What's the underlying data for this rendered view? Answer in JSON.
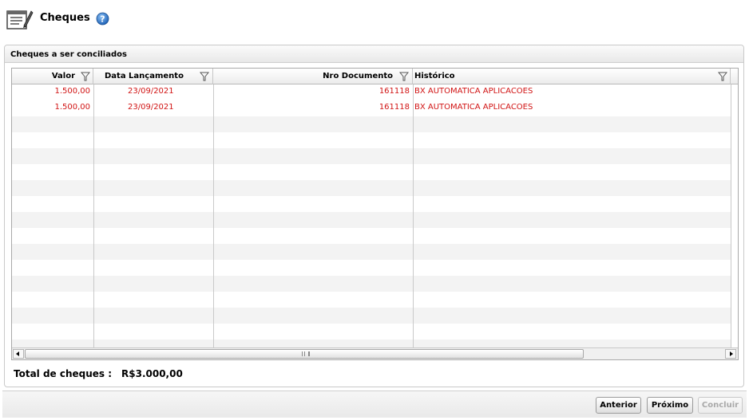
{
  "header": {
    "title": "Cheques"
  },
  "panel": {
    "title": "Cheques a ser conciliados",
    "columns": [
      "Valor",
      "Data Lançamento",
      "Nro Documento",
      "Histórico"
    ],
    "rows": [
      {
        "valor": "1.500,00",
        "data": "23/09/2021",
        "nro": "161118",
        "historico": "BX AUTOMATICA APLICACOES"
      },
      {
        "valor": "1.500,00",
        "data": "23/09/2021",
        "nro": "161118",
        "historico": "BX AUTOMATICA APLICACOES"
      }
    ],
    "total_label": "Total de cheques :",
    "total_value": "R$3.000,00"
  },
  "footer": {
    "anterior": "Anterior",
    "proximo": "Próximo",
    "concluir": "Concluir"
  },
  "colors": {
    "row_text": "#d11414",
    "help_icon": "#2f77c9"
  },
  "icons": [
    "document-edit-icon",
    "help-icon",
    "filter-icon",
    "scroll-left-icon",
    "scroll-right-icon"
  ]
}
